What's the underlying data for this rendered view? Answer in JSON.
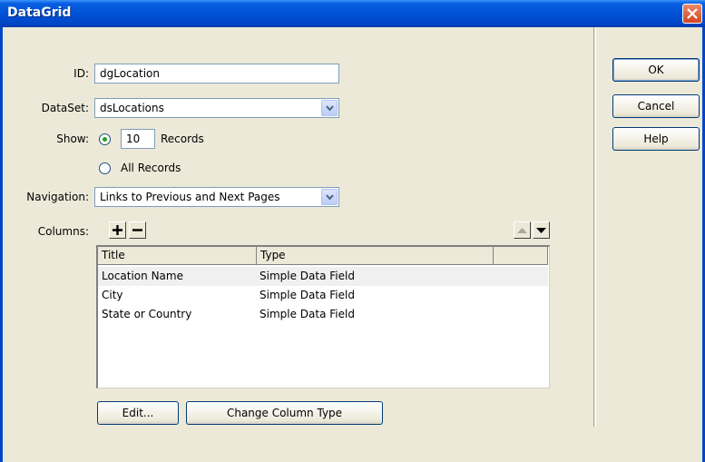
{
  "window": {
    "title": "DataGrid"
  },
  "form": {
    "id_label": "ID:",
    "id_value": "dgLocation",
    "dataset_label": "DataSet:",
    "dataset_value": "dsLocations",
    "show_label": "Show:",
    "records_count": "10",
    "records_label": "Records",
    "all_records_label": "All Records",
    "show_selected": "records",
    "navigation_label": "Navigation:",
    "navigation_value": "Links to Previous and Next Pages",
    "columns_label": "Columns:"
  },
  "columns_table": {
    "headers": [
      "Title",
      "Type"
    ],
    "rows": [
      {
        "title": "Location Name",
        "type": "Simple Data Field"
      },
      {
        "title": "City",
        "type": "Simple Data Field"
      },
      {
        "title": "State or Country",
        "type": "Simple Data Field"
      }
    ]
  },
  "buttons": {
    "ok": "OK",
    "cancel": "Cancel",
    "help": "Help",
    "edit": "Edit...",
    "change_type": "Change Column Type"
  },
  "colors": {
    "titlebar": "#0052d6",
    "dialog_bg": "#ece9d8",
    "radio_dot": "#21a121"
  }
}
